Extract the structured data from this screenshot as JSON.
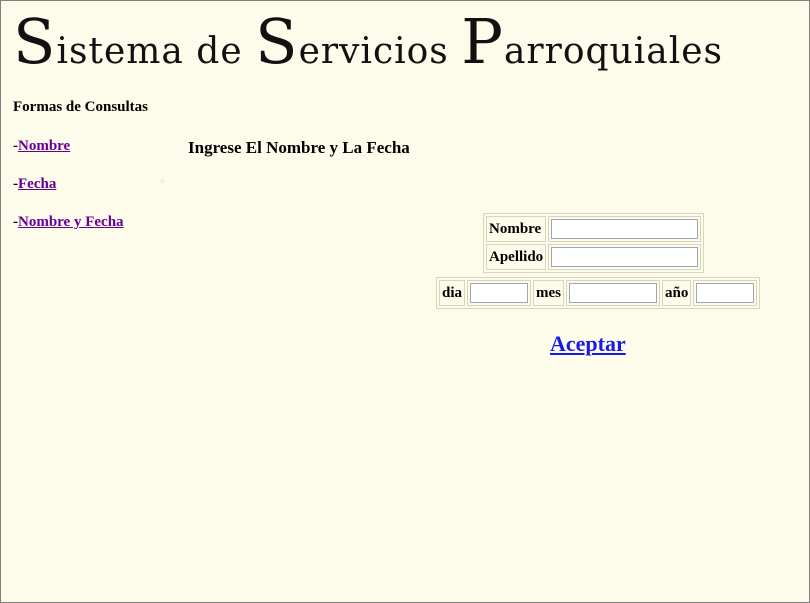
{
  "banner": {
    "cap1": "S",
    "word1": "istema de ",
    "cap2": "S",
    "word2": "ervicios ",
    "cap3": "P",
    "word3": "arroquiales"
  },
  "sidebar": {
    "title": "Formas de Consultas",
    "prefix": "-",
    "items": [
      {
        "label": "Nombre"
      },
      {
        "label": "Fecha"
      },
      {
        "label": "Nombre y Fecha"
      }
    ]
  },
  "main": {
    "heading": "Ingrese El Nombre y La Fecha",
    "fields": {
      "nombre_label": "Nombre",
      "nombre_value": "",
      "apellido_label": "Apellido",
      "apellido_value": "",
      "dia_label": "dia",
      "dia_value": "",
      "mes_label": "mes",
      "mes_value": "",
      "ano_label": "año",
      "ano_value": ""
    },
    "submit_label": "Aceptar"
  },
  "colors": {
    "background": "#fdfbea",
    "visited_link": "#660099",
    "link": "#1a1ae6"
  }
}
